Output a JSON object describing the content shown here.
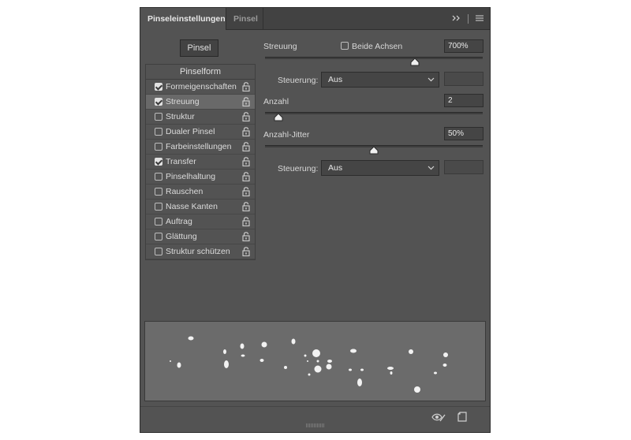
{
  "tabs": [
    {
      "label": "Pinseleinstellungen",
      "active": true
    },
    {
      "label": "Pinsel",
      "active": false
    }
  ],
  "header_icons": [
    "collapse-arrows-icon",
    "menu-icon"
  ],
  "pinsel_button": "Pinsel",
  "brush_list": {
    "header": "Pinselform",
    "items": [
      {
        "label": "Formeigenschaften",
        "checked": true,
        "selected": false
      },
      {
        "label": "Streuung",
        "checked": true,
        "selected": true
      },
      {
        "label": "Struktur",
        "checked": false,
        "selected": false
      },
      {
        "label": "Dualer Pinsel",
        "checked": false,
        "selected": false
      },
      {
        "label": "Farbeinstellungen",
        "checked": false,
        "selected": false
      },
      {
        "label": "Transfer",
        "checked": true,
        "selected": false
      },
      {
        "label": "Pinselhaltung",
        "checked": false,
        "selected": false
      },
      {
        "label": "Rauschen",
        "checked": false,
        "selected": false
      },
      {
        "label": "Nasse Kanten",
        "checked": false,
        "selected": false
      },
      {
        "label": "Auftrag",
        "checked": false,
        "selected": false
      },
      {
        "label": "Glättung",
        "checked": false,
        "selected": false
      },
      {
        "label": "Struktur schützen",
        "checked": false,
        "selected": false
      }
    ]
  },
  "settings": {
    "streuung": {
      "label": "Streuung",
      "value": "700%",
      "slider": 0.69,
      "beide_achsen_label": "Beide Achsen",
      "beide_achsen_checked": false
    },
    "steuerung1": {
      "label": "Steuerung:",
      "value": "Aus"
    },
    "anzahl": {
      "label": "Anzahl",
      "value": "2",
      "slider": 0.06
    },
    "anzahl_jitter": {
      "label": "Anzahl-Jitter",
      "value": "50%",
      "slider": 0.5
    },
    "steuerung2": {
      "label": "Steuerung:",
      "value": "Aus"
    }
  },
  "bottom_icons": [
    "eye-brush-icon",
    "new-preset-icon"
  ],
  "colors": {
    "panel": "#535353",
    "tabbar": "#424242",
    "preview_bg": "#6b6b6b",
    "selected_row": "#696969"
  }
}
